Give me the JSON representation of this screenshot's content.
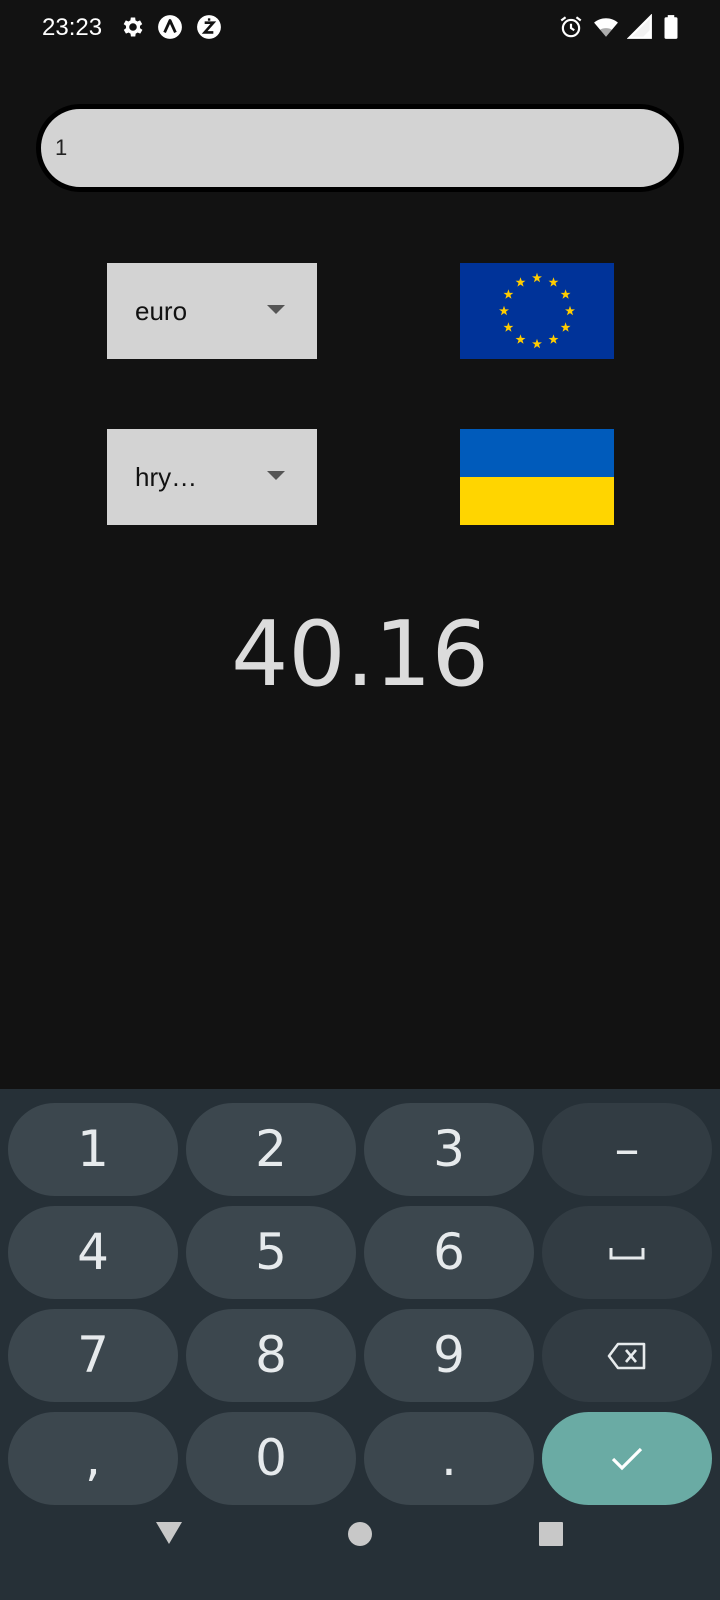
{
  "status_bar": {
    "time": "23:23",
    "left_icons": [
      "settings-icon",
      "app-a-icon",
      "app-z-icon"
    ],
    "right_icons": [
      "alarm-icon",
      "wifi-icon",
      "signal-icon",
      "battery-icon"
    ]
  },
  "converter": {
    "amount_value": "1",
    "from_currency": "euro",
    "from_flag": "eu-flag",
    "to_currency": "hry…",
    "to_flag": "ukraine-flag",
    "result": "40.16"
  },
  "keyboard": {
    "keys": [
      {
        "label": "1"
      },
      {
        "label": "2"
      },
      {
        "label": "3"
      },
      {
        "label": "–"
      },
      {
        "label": "4"
      },
      {
        "label": "5"
      },
      {
        "label": "6"
      },
      {
        "label": "space-icon"
      },
      {
        "label": "7"
      },
      {
        "label": "8"
      },
      {
        "label": "9"
      },
      {
        "label": "backspace-icon"
      },
      {
        "label": ","
      },
      {
        "label": "0"
      },
      {
        "label": "."
      },
      {
        "label": "check-icon"
      }
    ]
  },
  "navbar": {
    "buttons": [
      "back-icon",
      "home-icon",
      "recents-icon"
    ]
  },
  "colors": {
    "background": "#121212",
    "field_bg": "#d3d3d3",
    "keyboard_bg": "#263037",
    "key_bg": "#3c474e",
    "enter_key": "#6aaba4",
    "eu_blue": "#003399",
    "eu_star": "#ffcc00",
    "ua_blue": "#005bbb",
    "ua_yellow": "#ffd500"
  }
}
